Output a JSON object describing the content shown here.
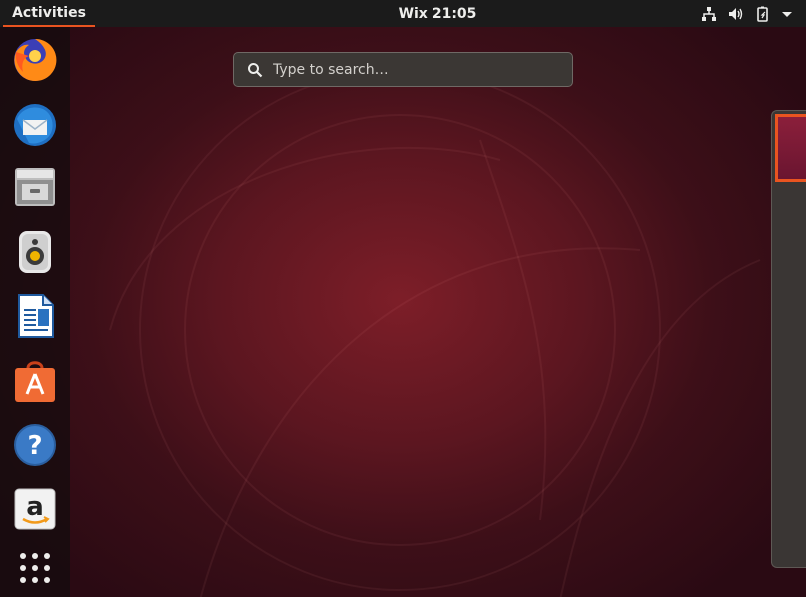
{
  "top_bar": {
    "activities_label": "Activities",
    "clock_day": "Wix",
    "clock_time": "21:05",
    "icons": [
      "network-icon",
      "volume-icon",
      "battery-icon",
      "system-menu-arrow-icon"
    ]
  },
  "dock": {
    "items": [
      {
        "name": "firefox-icon"
      },
      {
        "name": "thunderbird-icon"
      },
      {
        "name": "files-icon"
      },
      {
        "name": "rhythmbox-icon"
      },
      {
        "name": "libreoffice-writer-icon"
      },
      {
        "name": "ubuntu-software-icon"
      },
      {
        "name": "help-icon"
      },
      {
        "name": "amazon-icon"
      },
      {
        "name": "show-applications-icon"
      }
    ]
  },
  "search": {
    "placeholder": "Type to search…"
  },
  "colors": {
    "accent": "#e95420",
    "top_bar": "#1b1b1b",
    "wallpaper_center": "#7d1e28"
  }
}
